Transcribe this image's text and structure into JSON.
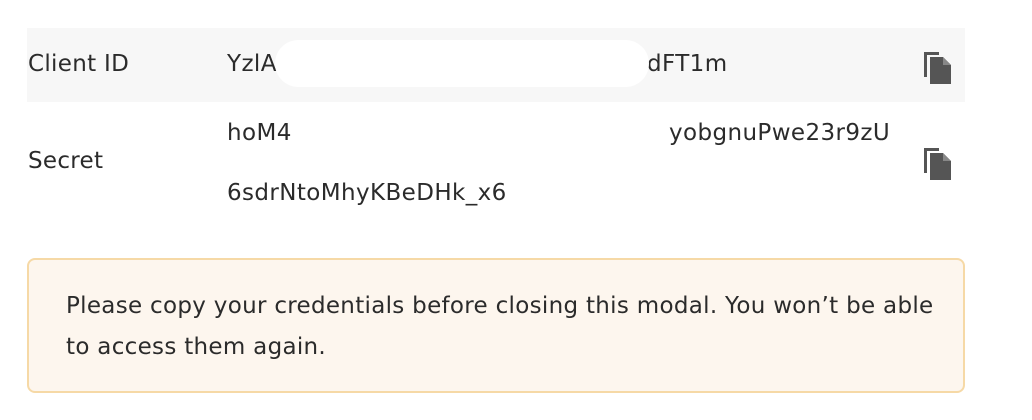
{
  "credentials": {
    "client_id": {
      "label": "Client ID",
      "value_visible_start": "YzlA",
      "value_visible_end": "dFT1m"
    },
    "secret": {
      "label": "Secret",
      "value_line1_start": "hoM4",
      "value_line1_end": "yobgnuPwe23r9zU",
      "value_line2": "6sdrNtoMhyKBeDHk_x6"
    },
    "copy_icon": "copy-icon"
  },
  "notice": {
    "text": "Please copy your credentials before closing this modal. You won’t be able to access them again.",
    "background": "#fdf6ee",
    "border": "#f6d9a6"
  }
}
